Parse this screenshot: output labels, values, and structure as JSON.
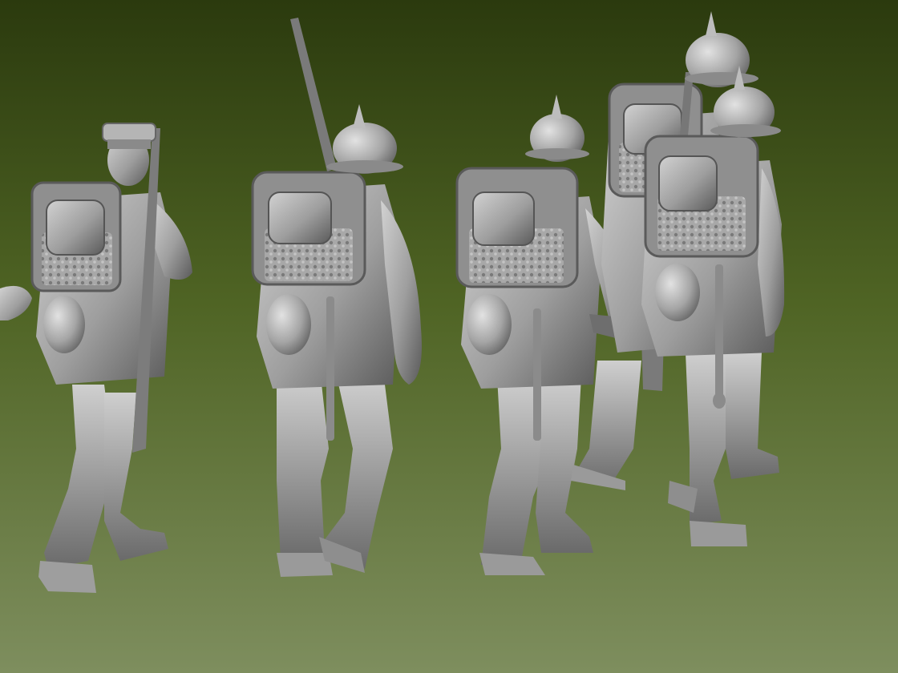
{
  "viewport": {
    "background_top": "#2b3a0e",
    "background_mid": "#4f6424",
    "background_bottom": "#7e8e5e"
  },
  "model": {
    "material_light": "#c7c7c7",
    "material_mid": "#9a9a9a",
    "material_dark": "#5e5e5e",
    "material_shadow": "#3e3e3e"
  },
  "figures": [
    {
      "id": "soldier-1",
      "headgear": "peaked-cap",
      "carries": "rifle-slung"
    },
    {
      "id": "soldier-2",
      "headgear": "pickelhaube",
      "carries": "rifle-shouldered"
    },
    {
      "id": "soldier-3",
      "headgear": "pickelhaube",
      "carries": "rifle-in-hand"
    },
    {
      "id": "soldier-4",
      "headgear": "pickelhaube",
      "carries": "rifle-slung"
    },
    {
      "id": "soldier-5",
      "headgear": "pickelhaube",
      "carries": "none"
    }
  ]
}
